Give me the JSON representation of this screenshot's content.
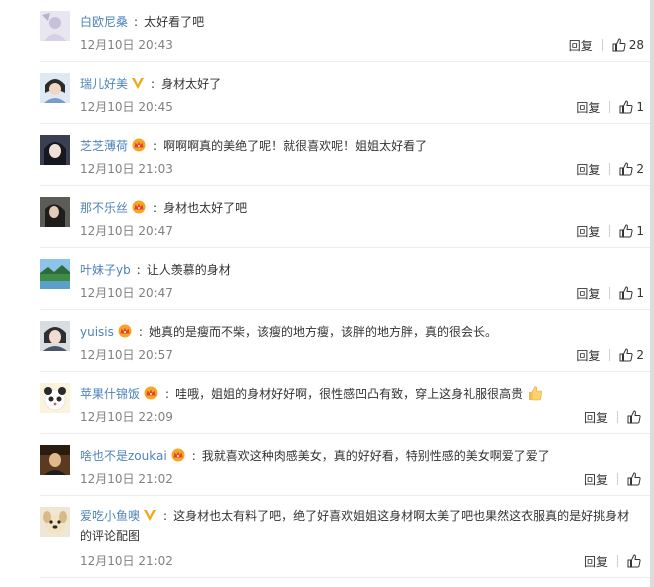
{
  "colors": {
    "username": "#4d83b9",
    "text": "#333333",
    "time": "#808080",
    "divider": "#ececec"
  },
  "comments": [
    {
      "username": "白欧尼桑",
      "badge": null,
      "text": "太好看了吧",
      "time": "12月10日 20:43",
      "reply": "回复",
      "likes": "28"
    },
    {
      "username": "瑞儿好美",
      "badge": "v-icon",
      "text": "身材太好了",
      "time": "12月10日 20:45",
      "reply": "回复",
      "likes": "1"
    },
    {
      "username": "芝芝薄荷",
      "badge": "crown-icon",
      "text": "啊啊啊真的美绝了呢！就很喜欢呢！姐姐太好看了",
      "time": "12月10日 21:03",
      "reply": "回复",
      "likes": "2"
    },
    {
      "username": "那不乐丝",
      "badge": "crown-icon",
      "text": "身材也太好了吧",
      "time": "12月10日 20:47",
      "reply": "回复",
      "likes": "1"
    },
    {
      "username": "叶妹子yb",
      "badge": null,
      "text": "让人羡慕的身材",
      "time": "12月10日 20:47",
      "reply": "回复",
      "likes": "1"
    },
    {
      "username": "yuisis",
      "badge": "crown-icon",
      "text": "她真的是瘦而不柴，该瘦的地方瘦，该胖的地方胖，真的很会长。",
      "time": "12月10日 20:57",
      "reply": "回复",
      "likes": "2"
    },
    {
      "username": "苹果什锦饭",
      "badge": "crown-icon",
      "text": "哇哦，姐姐的身材好好啊，很性感凹凸有致，穿上这身礼服很高贵",
      "emoji": "thumbs-up-emoji",
      "time": "12月10日 22:09",
      "reply": "回复",
      "likes": ""
    },
    {
      "username": "啥也不是zoukai",
      "badge": "crown-icon",
      "text": "我就喜欢这种肉感美女，真的好好看，特别性感的美女啊爱了爱了",
      "time": "12月10日 21:02",
      "reply": "回复",
      "likes": ""
    },
    {
      "username": "爱吃小鱼噢",
      "badge": "v-icon",
      "text": "这身材也太有料了吧，绝了好喜欢姐姐这身材啊太美了吧也果然这衣服真的是好挑身材的评论配图",
      "time": "12月10日 21:02",
      "reply": "回复",
      "likes": ""
    }
  ]
}
